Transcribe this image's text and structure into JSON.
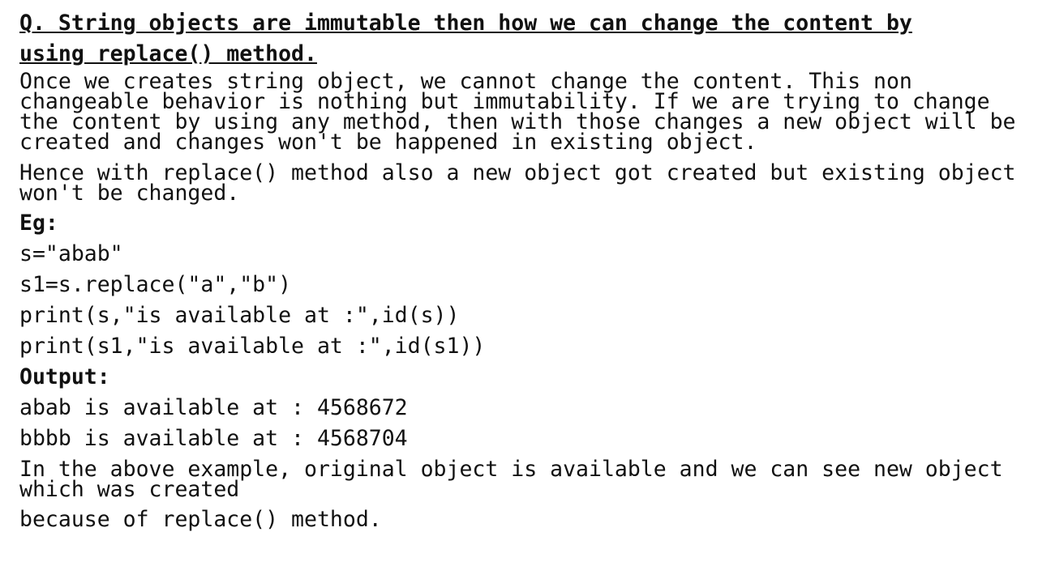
{
  "document": {
    "title_line1": "Q. String objects are immutable then how we can change the content by",
    "title_line2": "using replace() method.",
    "para1": "Once we creates string object, we cannot change the content. This non changeable behavior is nothing but immutability. If we are trying to change the content by using any method, then with those changes a new object will be created and changes won't be happened in existing object.",
    "para2": "Hence with replace() method also a new object got created but existing object won't be changed.",
    "example_label": "Eg:",
    "code": [
      "s=\"abab\"",
      "s1=s.replace(\"a\",\"b\")",
      "print(s,\"is available at :\",id(s))",
      "print(s1,\"is available at :\",id(s1))"
    ],
    "output_label": "Output:",
    "output": [
      "abab is available at : 4568672",
      "bbbb is available at : 4568704"
    ],
    "para3": "In the above example, original object is available and we can see new object which was created",
    "para3_tail": "because of replace() method."
  }
}
